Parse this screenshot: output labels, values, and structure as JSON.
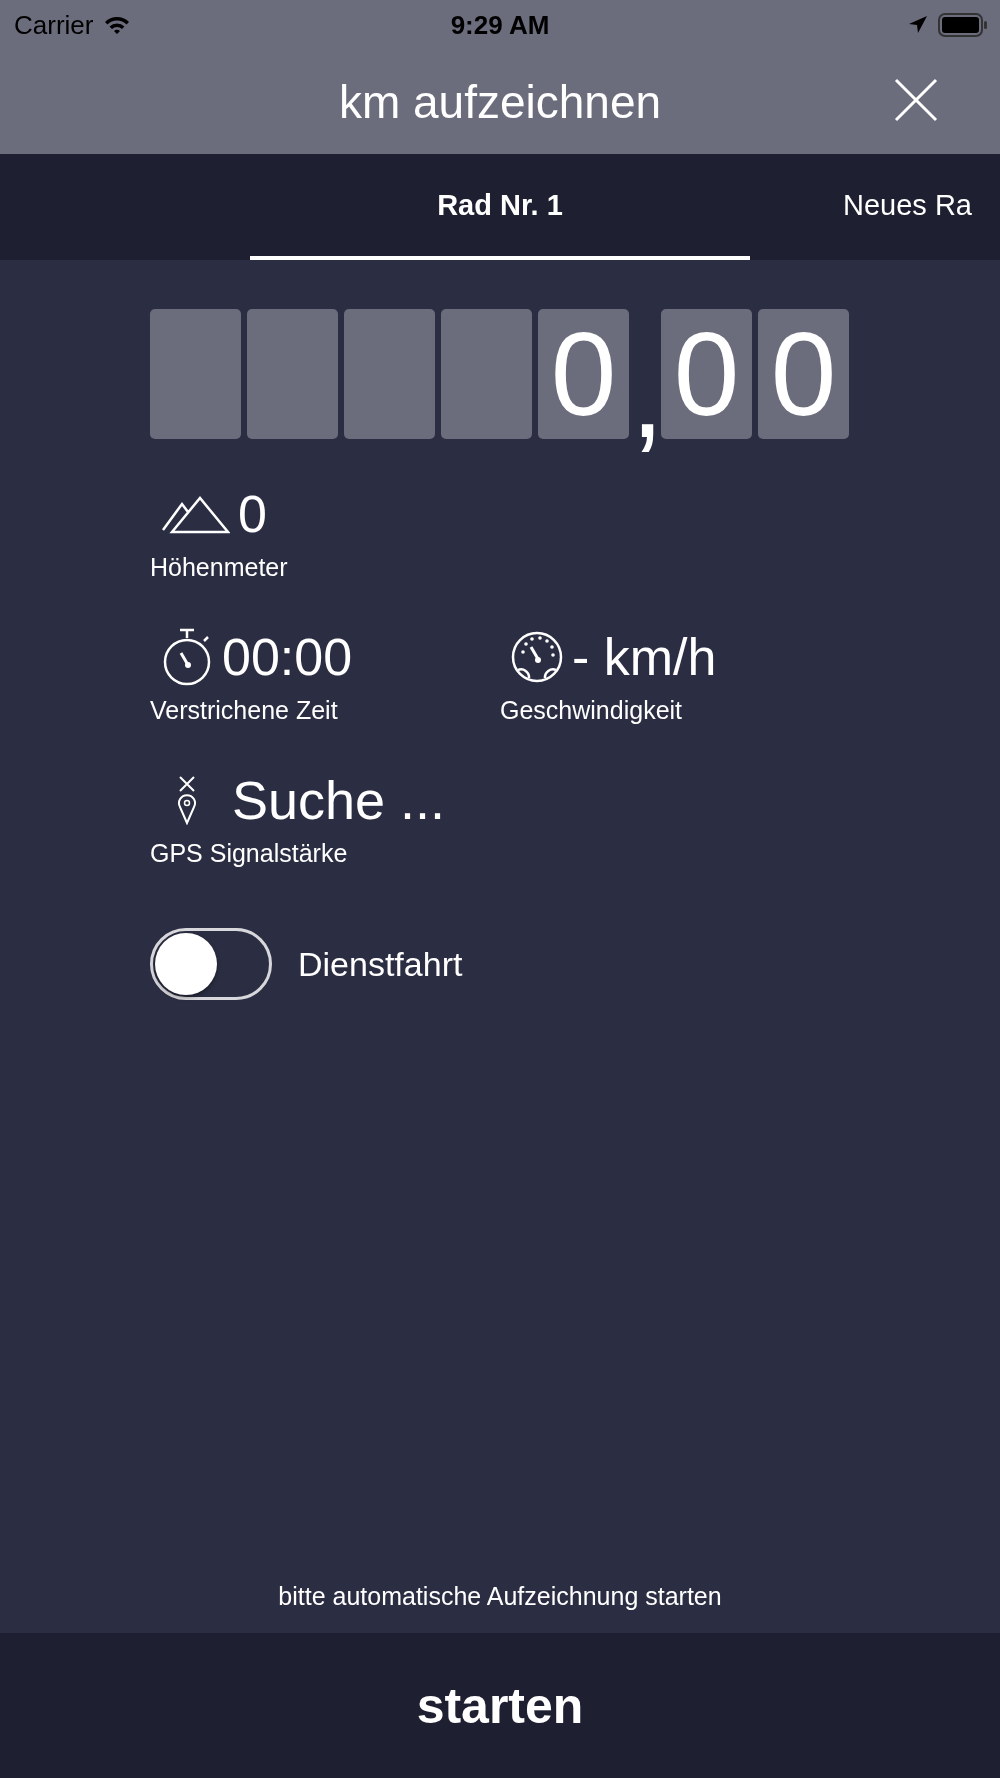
{
  "status_bar": {
    "carrier": "Carrier",
    "time": "9:29 AM"
  },
  "header": {
    "title": "km aufzeichnen"
  },
  "tabs": [
    {
      "label": "Rad Nr. 1",
      "selected": true
    },
    {
      "label": "Neues Ra",
      "selected": false
    }
  ],
  "odometer": {
    "digits": [
      {
        "kind": "blank"
      },
      {
        "kind": "blank"
      },
      {
        "kind": "blank"
      },
      {
        "kind": "blank"
      },
      {
        "kind": "digit",
        "text": "0"
      }
    ],
    "separator": ",",
    "decimals": [
      {
        "kind": "digit",
        "text": "0"
      },
      {
        "kind": "digit",
        "text": "0"
      }
    ]
  },
  "stats": [
    {
      "kind": "altitude",
      "value": "0",
      "label": "Höhenmeter"
    },
    {
      "kind": "time",
      "value": "00:00",
      "label": "Verstrichene Zeit"
    },
    {
      "kind": "speed",
      "value": "- km/h",
      "label": "Geschwindigkeit"
    },
    {
      "kind": "gps",
      "value": "Suche ...",
      "label": "GPS Signalstärke"
    }
  ],
  "business_trip": {
    "label": "Dienstfahrt",
    "on": false
  },
  "hint": "bitte automatische Aufzeichnung starten",
  "start_button": "starten"
}
